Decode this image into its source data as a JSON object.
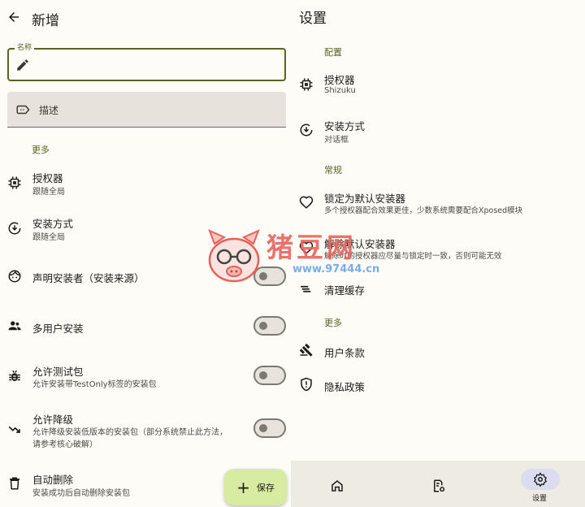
{
  "left": {
    "back_icon": "arrow-back-icon",
    "title": "新增",
    "name_field": {
      "label": "名称",
      "value": ""
    },
    "desc_field": {
      "placeholder": "描述"
    },
    "section_more": "更多",
    "items": [
      {
        "title": "授权器",
        "subtitle": "跟随全局",
        "icon": "chip-icon"
      },
      {
        "title": "安装方式",
        "subtitle": "跟随全局",
        "icon": "install-icon"
      },
      {
        "title": "声明安装者（安装来源）",
        "subtitle": "",
        "icon": "face-icon"
      },
      {
        "title": "多用户安装",
        "subtitle": "",
        "icon": "group-icon"
      },
      {
        "title": "允许测试包",
        "subtitle": "允许安装带TestOnly标签的安装包",
        "icon": "bug-icon"
      },
      {
        "title": "允许降级",
        "subtitle": "允许降级安装低版本的安装包（部分系统禁止此方法，",
        "subtitle2": "请参考核心破解）",
        "icon": "trend-down-icon"
      },
      {
        "title": "自动删除",
        "subtitle": "安装成功后自动删除安装包",
        "icon": "trash-icon"
      }
    ],
    "fab_label": "保存"
  },
  "right": {
    "title": "设置",
    "section_config": "配置",
    "section_general": "常规",
    "section_more": "更多",
    "items": [
      {
        "title": "授权器",
        "subtitle": "Shizuku",
        "icon": "chip-icon"
      },
      {
        "title": "安装方式",
        "subtitle": "对话框",
        "icon": "install-icon"
      },
      {
        "title": "锁定为默认安装器",
        "subtitle": "多个授权器配合效果更佳，少数系统需要配合Xposed模块",
        "icon": "heart-icon"
      },
      {
        "title": "解除默认安装器",
        "subtitle": "解除时的授权器应尽量与锁定时一致，否则可能无效",
        "icon": "heart-outline-icon"
      },
      {
        "title": "清理缓存",
        "subtitle": "",
        "icon": "clear-icon"
      },
      {
        "title": "用户条款",
        "subtitle": "",
        "icon": "gavel-icon"
      },
      {
        "title": "隐私政策",
        "subtitle": "",
        "icon": "shield-icon"
      }
    ],
    "nav": {
      "home_icon": "home-icon",
      "apps_icon": "apps-settings-icon",
      "settings_icon": "settings-icon",
      "settings_label": "设置"
    }
  },
  "watermark": {
    "text": "猪豆网",
    "url": "www.97444.cn"
  },
  "colors": {
    "accent": "#5b6420",
    "fab": "#d7eca0",
    "nav_pill": "#dcdcf0",
    "background": "#fdfcf7"
  }
}
